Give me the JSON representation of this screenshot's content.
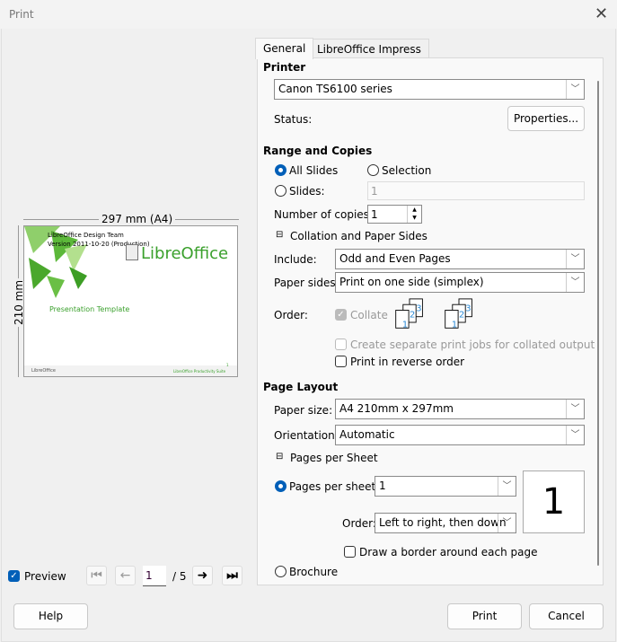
{
  "window": {
    "title": "Print",
    "close_icon": "close-icon"
  },
  "preview": {
    "width_label": "297 mm (A4)",
    "height_label": "210 mm",
    "slide": {
      "line1": "LibreOffice Design Team",
      "line2": "Version 2011-10-20 (Production)",
      "logo": "LibreOffice",
      "subtitle": "Presentation Template",
      "footer_logo": "LibreOffice",
      "footer_right": "LibreOffice Productivity Suite",
      "page_num": "1"
    },
    "preview_label": "Preview",
    "preview_checked": true,
    "current_page": "1",
    "total_pages": "/ 5"
  },
  "tabs": [
    {
      "label": "General",
      "active": true
    },
    {
      "label": "LibreOffice Impress",
      "active": false
    }
  ],
  "printer": {
    "heading": "Printer",
    "selected": "Canon TS6100 series",
    "status_label": "Status:",
    "properties_button": "Properties..."
  },
  "range": {
    "heading": "Range and Copies",
    "all_slides": "All Slides",
    "selection": "Selection",
    "slides": "Slides:",
    "slides_value": "1",
    "copies_label": "Number of copies:",
    "copies_value": "1"
  },
  "collation": {
    "heading": "Collation and Paper Sides",
    "include_label": "Include:",
    "include_value": "Odd and Even Pages",
    "sides_label": "Paper sides:",
    "sides_value": "Print on one side (simplex)",
    "order_label": "Order:",
    "collate": "Collate",
    "collate_checked": true,
    "separate_jobs": "Create separate print jobs for collated output",
    "reverse": "Print in reverse order"
  },
  "layout": {
    "heading": "Page Layout",
    "paper_size_label": "Paper size:",
    "paper_size_value": "A4 210mm x 297mm",
    "orientation_label": "Orientation:",
    "orientation_value": "Automatic",
    "pps_heading": "Pages per Sheet",
    "pps_label": "Pages per sheet:",
    "pps_value": "1",
    "order_label": "Order:",
    "order_value": "Left to right, then down",
    "preview_number": "1",
    "border": "Draw a border around each page",
    "brochure": "Brochure"
  },
  "buttons": {
    "help": "Help",
    "print": "Print",
    "cancel": "Cancel"
  },
  "colors": {
    "accent": "#005fb8",
    "slide_green": "#3aa02c"
  }
}
